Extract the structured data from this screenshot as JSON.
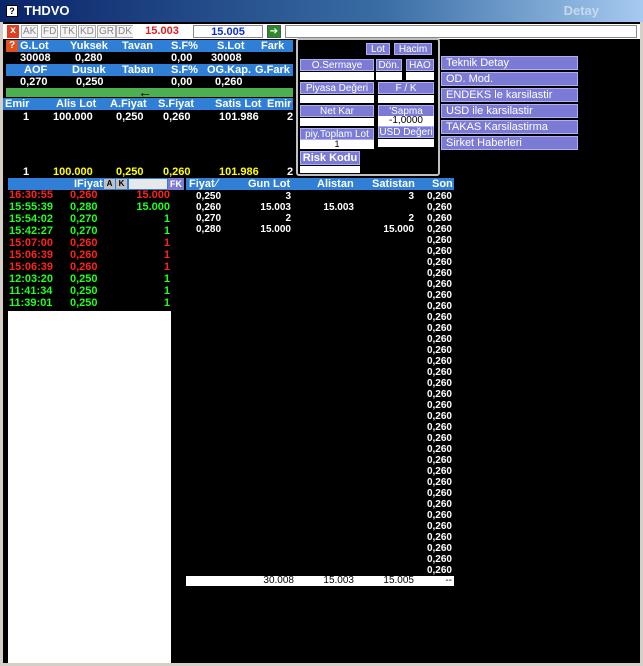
{
  "window": {
    "title": "THDVO",
    "right_title": "Detay",
    "icon": "app-icon"
  },
  "toolbar": {
    "close": "x",
    "buttons": [
      "AK",
      "FD",
      "TK",
      "KD",
      "GR",
      "DK"
    ],
    "bid_price": "15.003",
    "ask_price": "15.005",
    "bid_color": "#e02020",
    "ask_color": "#1030d0"
  },
  "summary": {
    "row1_headers": [
      "G.Lot",
      "Yuksek",
      "Tavan",
      "S.F%",
      "S.Lot",
      "Fark"
    ],
    "row1_values": [
      "30008",
      "0,280",
      "",
      "0,00",
      "30008",
      ""
    ],
    "row2_headers": [
      "AOF",
      "Dusuk",
      "Taban",
      "S.F%",
      "OG.Kap.",
      "G.Fark"
    ],
    "row2_values": [
      "0,270",
      "0,250",
      "",
      "0,00",
      "0,260",
      ""
    ],
    "arrow": "←"
  },
  "orders": {
    "headers": [
      "Emir",
      "Alis Lot",
      "A.Fiyat",
      "S.Fiyat",
      "Satis Lot",
      "Emir"
    ],
    "row": [
      "1",
      "100.000",
      "0,250",
      "0,260",
      "101.986",
      "2"
    ],
    "total": [
      "1",
      "100.000",
      "0,250",
      "0,260",
      "101.986",
      "2"
    ]
  },
  "popup": {
    "lot": "Lot",
    "hacim": "Hacim",
    "osermaye": "O.Sermaye",
    "don": "Dön.",
    "hao": "HAO",
    "piyasa_degeri": "Piyasa Değeri",
    "fk": "F / K",
    "net_kar": "Net Kar",
    "sapma": "'Sapma",
    "sapma_value": "-1,0000",
    "piy_toplam": "piy.Toplam Lot",
    "piy_toplam_value": "1",
    "usd_degeri": "USD Değeri",
    "risk_kodu": "Risk Kodu"
  },
  "menu": [
    "Teknik Detay",
    "OD. Mod.",
    "ENDEKS le karsilastir",
    "USD ile karsilastir",
    "TAKAS Karsilastirma",
    "Sirket Haberleri"
  ],
  "trades": {
    "header_fiyat": "IFiyat",
    "header_a": "A",
    "header_k": "K",
    "header_fk": "FK",
    "rows": [
      {
        "time": "16:30:55",
        "price": "0,260",
        "lot": "15.000",
        "color": "#ff2020"
      },
      {
        "time": "15:55:39",
        "price": "0,280",
        "lot": "15.000",
        "color": "#20ff20"
      },
      {
        "time": "15:54:02",
        "price": "0,270",
        "lot": "1",
        "color": "#20ff20"
      },
      {
        "time": "15:42:27",
        "price": "0,270",
        "lot": "1",
        "color": "#20ff20"
      },
      {
        "time": "15:07:00",
        "price": "0,260",
        "lot": "1",
        "color": "#ff2020"
      },
      {
        "time": "15:06:39",
        "price": "0,260",
        "lot": "1",
        "color": "#ff2020"
      },
      {
        "time": "15:06:39",
        "price": "0,260",
        "lot": "1",
        "color": "#ff2020"
      },
      {
        "time": "12:03:20",
        "price": "0,250",
        "lot": "1",
        "color": "#20ff20"
      },
      {
        "time": "11:41:34",
        "price": "0,250",
        "lot": "1",
        "color": "#20ff20"
      },
      {
        "time": "11:39:01",
        "price": "0,250",
        "lot": "1",
        "color": "#20ff20"
      }
    ]
  },
  "depth": {
    "headers": [
      "Fiyat",
      "Gun Lot",
      "Alistan",
      "Satistan",
      "Son"
    ],
    "sort_icon": "sort-icon",
    "rows": [
      {
        "fiyat": "0,250",
        "gun": "3",
        "alis": "",
        "satis": "3",
        "son": "0,260"
      },
      {
        "fiyat": "0,260",
        "gun": "15.003",
        "alis": "15.003",
        "satis": "",
        "son": "0,260"
      },
      {
        "fiyat": "0,270",
        "gun": "2",
        "alis": "",
        "satis": "2",
        "son": "0,260"
      },
      {
        "fiyat": "0,280",
        "gun": "15.000",
        "alis": "",
        "satis": "15.000",
        "son": "0,260"
      }
    ],
    "son_value": "0,260",
    "son_count": 35,
    "footer": {
      "gun": "30.008",
      "alis": "15.003",
      "satis": "15.005",
      "son": "--"
    }
  }
}
